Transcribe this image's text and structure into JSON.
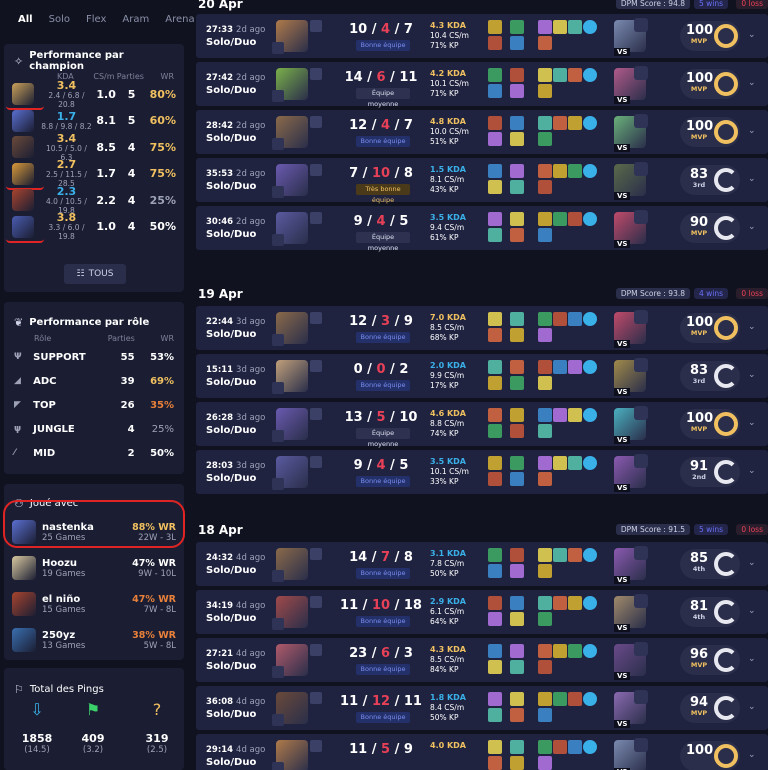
{
  "nav": {
    "tabs": [
      "All",
      "Solo",
      "Flex",
      "Aram",
      "Arena"
    ],
    "active": "All"
  },
  "champ_panel": {
    "title": "Performance par champion",
    "cols": [
      "KDA",
      "CS/m",
      "Parties",
      "WR"
    ],
    "tous": "TOUS",
    "rows": [
      {
        "kda": "3.4",
        "detail": "2.4 / 6.8 / 20.8",
        "cs": "1.0",
        "games": "5",
        "wr": "80%",
        "wrColor": "#f0c060",
        "avColor": "#c9a15a"
      },
      {
        "kda": "1.7",
        "detail": "8.8 / 9.8 / 8.2",
        "cs": "8.1",
        "games": "5",
        "wr": "60%",
        "wrColor": "#f0c060",
        "avColor": "#5a6fd0"
      },
      {
        "kda": "3.4",
        "detail": "10.5 / 5.0 / 6.3",
        "cs": "8.5",
        "games": "4",
        "wr": "75%",
        "wrColor": "#f0c060",
        "avColor": "#6b4a3a"
      },
      {
        "kda": "2.7",
        "detail": "2.5 / 11.5 / 28.5",
        "cs": "1.7",
        "games": "4",
        "wr": "75%",
        "wrColor": "#f0c060",
        "avColor": "#d99a3a"
      },
      {
        "kda": "2.3",
        "detail": "4.0 / 10.5 / 19.8",
        "cs": "2.2",
        "games": "4",
        "wr": "25%",
        "wrColor": "#9ea2b8",
        "avColor": "#a8442e"
      },
      {
        "kda": "3.8",
        "detail": "3.3 / 6.0 / 19.8",
        "cs": "1.0",
        "games": "4",
        "wr": "50%",
        "wrColor": "#ffffff",
        "avColor": "#4a5cb0"
      }
    ]
  },
  "role_panel": {
    "title": "Performance par rôle",
    "col_role": "Rôle",
    "col_games": "Parties",
    "col_wr": "WR",
    "rows": [
      {
        "icon": "Ψ",
        "name": "SUPPORT",
        "games": "55",
        "wr": "53%",
        "wrColor": "#ffffff"
      },
      {
        "icon": "◢",
        "name": "ADC",
        "games": "39",
        "wr": "69%",
        "wrColor": "#f0c060"
      },
      {
        "icon": "◤",
        "name": "TOP",
        "games": "26",
        "wr": "35%",
        "wrColor": "#e8803a"
      },
      {
        "icon": "ψ",
        "name": "JUNGLE",
        "games": "4",
        "wr": "25%",
        "wrColor": "#9ea2b8"
      },
      {
        "icon": "⁄",
        "name": "MID",
        "games": "2",
        "wr": "50%",
        "wrColor": "#ffffff"
      }
    ]
  },
  "friends_panel": {
    "title": "Joué avec",
    "rows": [
      {
        "name": "nastenka",
        "games": "25 Games",
        "wr": "88% WR",
        "wrColor": "#f0c060",
        "record": "22W - 3L",
        "avColor": "#5a6fd0"
      },
      {
        "name": "Hoozu",
        "games": "19 Games",
        "wr": "47% WR",
        "wrColor": "#ffffff",
        "record": "9W - 10L",
        "avColor": "#d9c9a0"
      },
      {
        "name": "el niño",
        "games": "15 Games",
        "wr": "47% WR",
        "wrColor": "#e8803a",
        "record": "7W - 8L",
        "avColor": "#a8442e"
      },
      {
        "name": "250yz",
        "games": "13 Games",
        "wr": "38% WR",
        "wrColor": "#e8803a",
        "record": "5W - 8L",
        "avColor": "#3a6fb0"
      }
    ]
  },
  "pings_panel": {
    "title": "Total des Pings",
    "cols": [
      {
        "icon": "⇩",
        "iconColor": "#3ab0e8",
        "value": "1858",
        "avg": "(14.5)"
      },
      {
        "icon": "⚑",
        "iconColor": "#3ad06a",
        "value": "409",
        "avg": "(3.2)"
      },
      {
        "icon": "?",
        "iconColor": "#f0c060",
        "value": "319",
        "avg": "(2.5)"
      }
    ]
  },
  "days": [
    {
      "date": "20 Apr",
      "dpm": "DPM Score : 94.8",
      "wins": "5 wins",
      "loss": "0 loss"
    },
    {
      "date": "19 Apr",
      "dpm": "DPM Score : 93.8",
      "wins": "4 wins",
      "loss": "0 loss"
    },
    {
      "date": "18 Apr",
      "dpm": "DPM Score : 91.5",
      "wins": "5 wins",
      "loss": "0 loss"
    }
  ],
  "matches": [
    {
      "time": "27:33",
      "ago": "2d ago",
      "mode": "Solo/Duo",
      "k": "10",
      "d": "4",
      "a": "7",
      "badge": "Bonne équipe",
      "kdaTxt": "4.3 KDA",
      "cs": "10.4 CS/m",
      "kp": "71% KP",
      "grade": "100",
      "label": "MVP",
      "ring": "full",
      "champColor": "#b07a4a",
      "vsColor": "#7a8ab0"
    },
    {
      "time": "27:42",
      "ago": "2d ago",
      "mode": "Solo/Duo",
      "k": "14",
      "d": "6",
      "a": "11",
      "badge": "Équipe moyenne",
      "kdaTxt": "4.2 KDA",
      "cs": "10.1 CS/m",
      "kp": "71% KP",
      "grade": "100",
      "label": "MVP",
      "ring": "full",
      "champColor": "#7ab04a",
      "vsColor": "#b05a8a"
    },
    {
      "time": "28:42",
      "ago": "2d ago",
      "mode": "Solo/Duo",
      "k": "12",
      "d": "4",
      "a": "7",
      "badge": "Bonne équipe",
      "kdaTxt": "4.8 KDA",
      "cs": "10.0 CS/m",
      "kp": "51% KP",
      "grade": "100",
      "label": "MVP",
      "ring": "full",
      "champColor": "#8a6a4a",
      "vsColor": "#6ab07a"
    },
    {
      "time": "35:53",
      "ago": "2d ago",
      "mode": "Solo/Duo",
      "k": "7",
      "d": "10",
      "a": "8",
      "badge": "Très bonne équipe",
      "kdaTxt": "1.5 KDA",
      "cs": "8.1 CS/m",
      "kp": "43% KP",
      "grade": "83",
      "label": "3rd",
      "ring": "part",
      "champColor": "#6a5ab0",
      "vsColor": "#5a6a4a"
    },
    {
      "time": "30:46",
      "ago": "2d ago",
      "mode": "Solo/Duo",
      "k": "9",
      "d": "4",
      "a": "5",
      "badge": "Équipe moyenne",
      "kdaTxt": "3.5 KDA",
      "cs": "9.4 CS/m",
      "kp": "61% KP",
      "grade": "90",
      "label": "MVP",
      "ring": "part",
      "champColor": "#5a5aa0",
      "vsColor": "#c04a6a"
    },
    {
      "time": "22:44",
      "ago": "3d ago",
      "mode": "Solo/Duo",
      "k": "12",
      "d": "3",
      "a": "9",
      "badge": "Bonne équipe",
      "kdaTxt": "7.0 KDA",
      "cs": "8.5 CS/m",
      "kp": "68% KP",
      "grade": "100",
      "label": "MVP",
      "ring": "full",
      "champColor": "#8a6a4a",
      "vsColor": "#c04a6a"
    },
    {
      "time": "15:11",
      "ago": "3d ago",
      "mode": "Solo/Duo",
      "k": "0",
      "d": "0",
      "a": "2",
      "badge": "Bonne équipe",
      "kdaTxt": "2.0 KDA",
      "cs": "9.9 CS/m",
      "kp": "17% KP",
      "grade": "83",
      "label": "3rd",
      "ring": "part",
      "champColor": "#c0a07a",
      "vsColor": "#a08a4a"
    },
    {
      "time": "26:28",
      "ago": "3d ago",
      "mode": "Solo/Duo",
      "k": "13",
      "d": "5",
      "a": "10",
      "badge": "Équipe moyenne",
      "kdaTxt": "4.6 KDA",
      "cs": "8.8 CS/m",
      "kp": "74% KP",
      "grade": "100",
      "label": "MVP",
      "ring": "full",
      "champColor": "#6a5ab0",
      "vsColor": "#4ab0c0"
    },
    {
      "time": "28:03",
      "ago": "3d ago",
      "mode": "Solo/Duo",
      "k": "9",
      "d": "4",
      "a": "5",
      "badge": "Bonne équipe",
      "kdaTxt": "3.5 KDA",
      "cs": "10.1 CS/m",
      "kp": "33% KP",
      "grade": "91",
      "label": "2nd",
      "ring": "part",
      "champColor": "#5a5aa0",
      "vsColor": "#8a5ab0"
    },
    {
      "time": "24:32",
      "ago": "4d ago",
      "mode": "Solo/Duo",
      "k": "14",
      "d": "7",
      "a": "8",
      "badge": "Bonne équipe",
      "kdaTxt": "3.1 KDA",
      "cs": "7.8 CS/m",
      "kp": "50% KP",
      "grade": "85",
      "label": "4th",
      "ring": "part",
      "champColor": "#8a6a4a",
      "vsColor": "#8a5ab0"
    },
    {
      "time": "34:19",
      "ago": "4d ago",
      "mode": "Solo/Duo",
      "k": "11",
      "d": "10",
      "a": "18",
      "badge": "Bonne équipe",
      "kdaTxt": "2.9 KDA",
      "cs": "6.1 CS/m",
      "kp": "64% KP",
      "grade": "81",
      "label": "4th",
      "ring": "part",
      "champColor": "#a04a4a",
      "vsColor": "#a08a6a"
    },
    {
      "time": "27:21",
      "ago": "4d ago",
      "mode": "Solo/Duo",
      "k": "23",
      "d": "6",
      "a": "3",
      "badge": "Bonne équipe",
      "kdaTxt": "4.3 KDA",
      "cs": "8.5 CS/m",
      "kp": "84% KP",
      "grade": "96",
      "label": "MVP",
      "ring": "part",
      "champColor": "#b05a6a",
      "vsColor": "#6a4a8a"
    },
    {
      "time": "36:08",
      "ago": "4d ago",
      "mode": "Solo/Duo",
      "k": "11",
      "d": "12",
      "a": "11",
      "badge": "Bonne équipe",
      "kdaTxt": "1.8 KDA",
      "cs": "8.4 CS/m",
      "kp": "50% KP",
      "grade": "94",
      "label": "MVP",
      "ring": "part",
      "champColor": "#6a4a3a",
      "vsColor": "#8a6ab0"
    },
    {
      "time": "29:14",
      "ago": "4d ago",
      "mode": "Solo/Duo",
      "k": "11",
      "d": "5",
      "a": "9",
      "badge": "",
      "kdaTxt": "4.0 KDA",
      "cs": "",
      "kp": "",
      "grade": "100",
      "label": "",
      "ring": "full",
      "champColor": "#b07a4a",
      "vsColor": "#7a8ab0"
    }
  ]
}
